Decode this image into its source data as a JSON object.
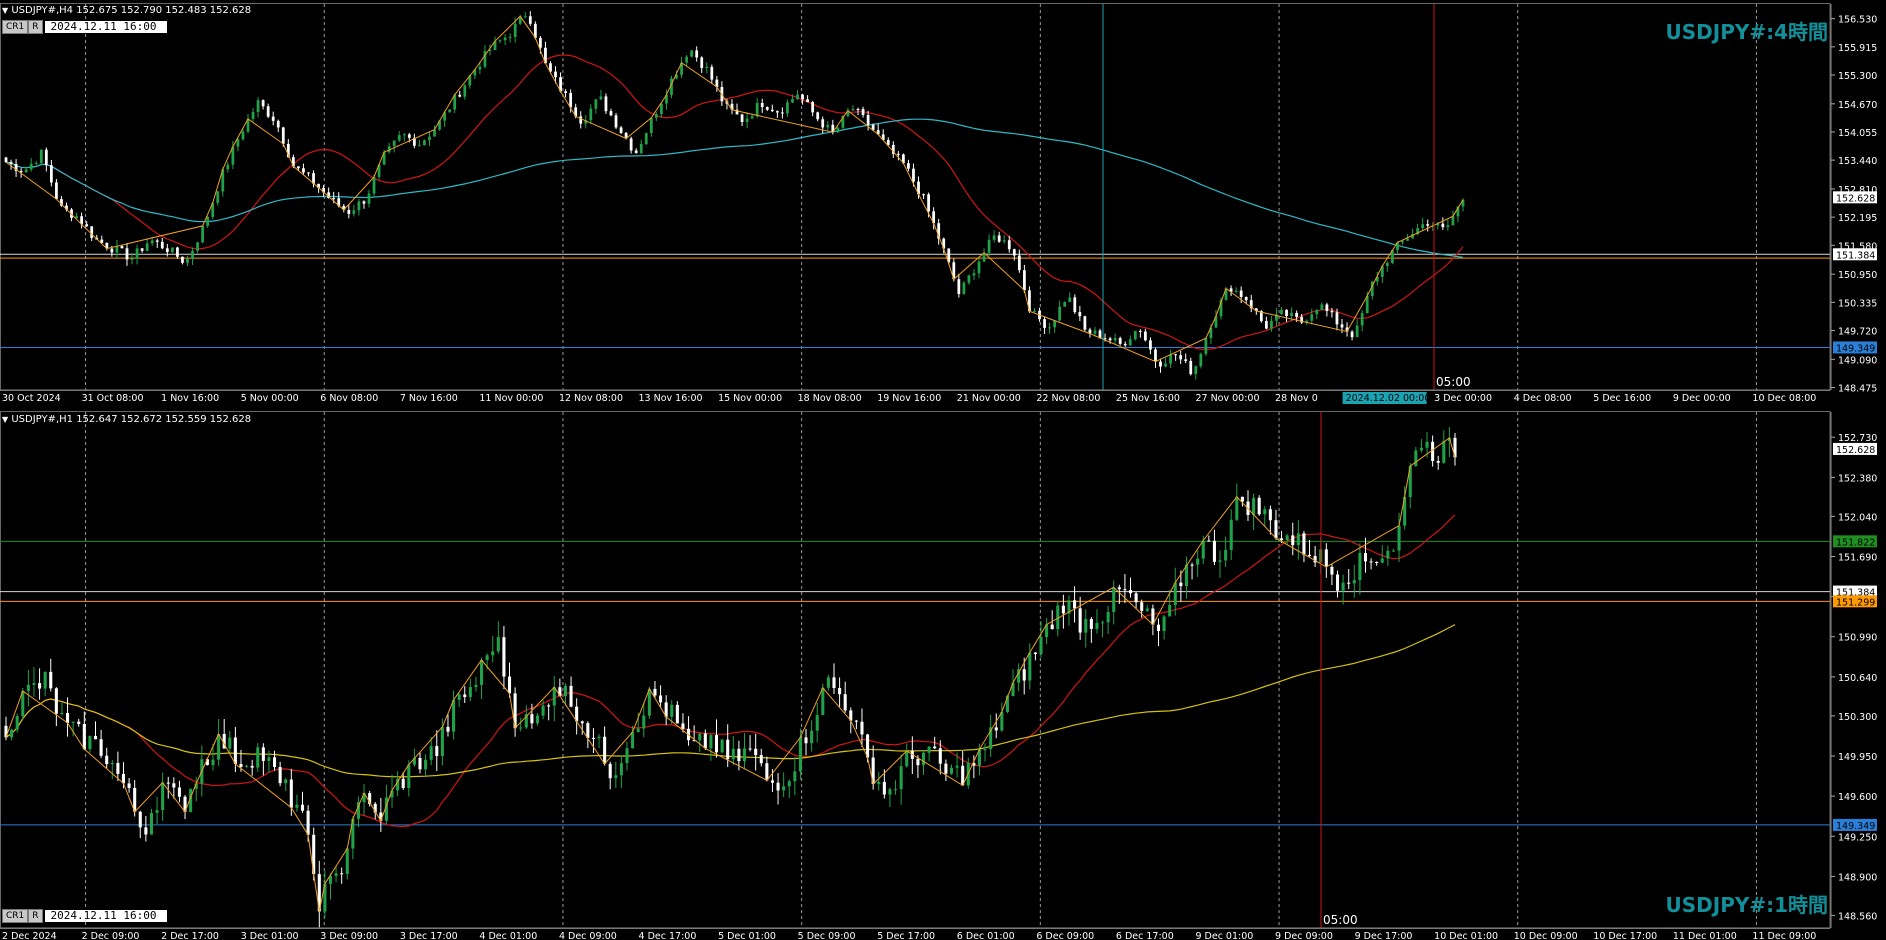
{
  "colors": {
    "up": "#1fa24a",
    "down": "#ffffff",
    "ma_red": "#d01515",
    "ma_cyan": "#2fb9c8",
    "ma_yellow": "#d4c20c",
    "zigzag": "#f0a020",
    "grid": "#9a9a9a",
    "hline_white": "#d8d8d8",
    "hline_orange": "#ff9a00",
    "hline_blue": "#2a7fd8",
    "hline_green": "#1f8f1f",
    "vline_red": "#d01515",
    "vline_cyan": "#1aa4b3"
  },
  "top": {
    "header": "USDJPY#,H4  152.675 152.790 152.483 152.628",
    "cr_label": "CR1",
    "r_label": "R",
    "date_input": "2024.12.11 16:00",
    "watermark": "USDJPY#:4時間",
    "vline_time_label": "05:00",
    "crosshair_badge": "2024.12.02 00:00",
    "price_labels": [
      "156.530",
      "155.915",
      "155.300",
      "154.670",
      "154.055",
      "153.440",
      "152.810",
      "152.195",
      "151.580",
      "150.950",
      "150.335",
      "149.720",
      "149.090",
      "148.475"
    ],
    "badges": [
      {
        "text": "152.628",
        "price": 152.628,
        "color": "#ffffff",
        "text_color": "#000000"
      },
      {
        "text": "151.384",
        "price": 151.384,
        "color": "#ffffff",
        "text_color": "#000000"
      },
      {
        "text": "149.349",
        "price": 149.349,
        "color": "#2a7fd8",
        "text_color": "#000000"
      }
    ],
    "hlines": [
      {
        "price": 151.384,
        "color": "#d8d8d8"
      },
      {
        "price": 151.3,
        "color": "#ff9a00"
      },
      {
        "price": 149.349,
        "color": "#2a7fd8"
      }
    ],
    "time_labels": [
      "30 Oct 2024",
      "31 Oct 08:00",
      "1 Nov 16:00",
      "5 Nov 00:00",
      "6 Nov 08:00",
      "7 Nov 16:00",
      "11 Nov 00:00",
      "12 Nov 08:00",
      "13 Nov 16:00",
      "15 Nov 00:00",
      "18 Nov 08:00",
      "19 Nov 16:00",
      "21 Nov 00:00",
      "22 Nov 08:00",
      "25 Nov 16:00",
      "27 Nov 00:00",
      "28 Nov 0",
      "",
      "3 Dec 00:00",
      "4 Dec 08:00",
      "5 Dec 16:00",
      "9 Dec 00:00",
      "10 Dec 08:00"
    ],
    "price_min": 148.42,
    "price_max": 156.85,
    "ohlc_anchor": [
      153.4,
      153.2,
      153.6,
      152.4,
      152.2,
      151.7,
      151.5,
      151.3,
      151.7,
      151.5,
      151.2,
      152.0,
      153.1,
      154.0,
      154.7,
      154.3,
      153.3,
      153.0,
      152.6,
      152.3,
      152.6,
      153.5,
      154.0,
      153.8,
      154.2,
      154.8,
      155.4,
      155.9,
      156.2,
      156.7,
      155.5,
      154.9,
      154.3,
      154.8,
      154.2,
      153.6,
      154.4,
      155.2,
      155.9,
      155.4,
      154.6,
      154.3,
      154.7,
      154.5,
      154.9,
      154.4,
      154.0,
      154.6,
      154.2,
      153.7,
      153.3,
      152.6,
      151.6,
      150.5,
      151.2,
      151.8,
      151.5,
      150.1,
      149.8,
      150.5,
      149.7,
      149.6,
      149.4,
      149.8,
      149.0,
      149.2,
      148.8,
      149.9,
      150.7,
      150.4,
      149.8,
      150.1,
      149.9,
      150.3,
      149.9,
      149.6,
      150.8,
      151.4,
      151.8,
      152.1,
      151.9,
      152.6
    ]
  },
  "bottom": {
    "header": "USDJPY#,H1  152.647 152.672 152.559 152.628",
    "cr_label": "CR1",
    "r_label": "R",
    "date_input": "2024.12.11 16:00",
    "watermark": "USDJPY#:1時間",
    "vline_time_label": "05:00",
    "price_labels": [
      "152.730",
      "152.380",
      "152.040",
      "151.690",
      "151.340",
      "150.990",
      "150.640",
      "150.300",
      "149.950",
      "149.600",
      "149.250",
      "148.900",
      "148.560"
    ],
    "badges": [
      {
        "text": "152.628",
        "price": 152.628,
        "color": "#ffffff",
        "text_color": "#000000"
      },
      {
        "text": "151.822",
        "price": 151.822,
        "color": "#1f8f1f",
        "text_color": "#000000"
      },
      {
        "text": "151.384",
        "price": 151.384,
        "color": "#ffffff",
        "text_color": "#000000"
      },
      {
        "text": "151.299",
        "price": 151.299,
        "color": "#ff9a00",
        "text_color": "#000000"
      },
      {
        "text": "149.349",
        "price": 149.349,
        "color": "#2a7fd8",
        "text_color": "#000000"
      }
    ],
    "hlines": [
      {
        "price": 151.822,
        "color": "#1f8f1f"
      },
      {
        "price": 151.384,
        "color": "#d8d8d8"
      },
      {
        "price": 151.299,
        "color": "#ff9a00"
      },
      {
        "price": 149.349,
        "color": "#2a7fd8"
      }
    ],
    "time_labels": [
      "2 Dec 2024",
      "2 Dec 09:00",
      "2 Dec 17:00",
      "3 Dec 01:00",
      "3 Dec 09:00",
      "3 Dec 17:00",
      "4 Dec 01:00",
      "4 Dec 09:00",
      "4 Dec 17:00",
      "5 Dec 01:00",
      "5 Dec 09:00",
      "5 Dec 17:00",
      "6 Dec 01:00",
      "6 Dec 09:00",
      "6 Dec 17:00",
      "9 Dec 01:00",
      "9 Dec 09:00",
      "9 Dec 17:00",
      "10 Dec 01:00",
      "10 Dec 09:00",
      "10 Dec 17:00",
      "11 Dec 01:00",
      "11 Dec 09:00"
    ],
    "price_min": 148.45,
    "price_max": 152.95,
    "ohlc_anchor": [
      150.2,
      150.5,
      150.6,
      150.2,
      150.1,
      150.0,
      149.7,
      149.3,
      149.7,
      149.5,
      149.9,
      150.1,
      149.9,
      150.0,
      149.7,
      149.5,
      148.7,
      148.9,
      149.6,
      149.4,
      149.7,
      149.9,
      150.0,
      150.4,
      150.6,
      151.0,
      150.3,
      150.2,
      150.6,
      150.4,
      150.1,
      149.8,
      150.2,
      150.5,
      150.3,
      150.0,
      150.1,
      149.9,
      150.0,
      149.7,
      149.8,
      150.2,
      150.6,
      150.4,
      149.9,
      149.6,
      149.9,
      150.0,
      149.8,
      149.8,
      150.0,
      150.4,
      150.7,
      151.0,
      151.3,
      151.1,
      151.2,
      151.4,
      151.2,
      151.0,
      151.5,
      151.8,
      151.7,
      152.2,
      152.1,
      151.9,
      151.8,
      151.7,
      151.5,
      151.6,
      151.7,
      151.8,
      152.7,
      152.6,
      152.63
    ]
  }
}
